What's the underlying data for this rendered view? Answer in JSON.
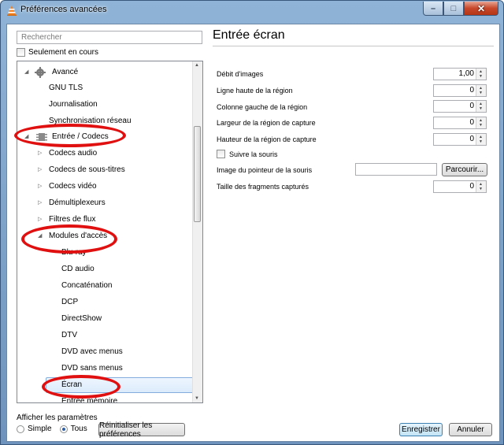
{
  "window": {
    "title": "Préférences avancées",
    "close_glyph": "✕",
    "min_glyph": "–",
    "max_glyph": "□"
  },
  "left": {
    "search_placeholder": "Rechercher",
    "only_current_label": "Seulement en cours",
    "tree": [
      {
        "label": "Avancé",
        "level": 0,
        "arrow": "◢",
        "icon": "gear-icon"
      },
      {
        "label": "GNU TLS",
        "level": 1
      },
      {
        "label": "Journalisation",
        "level": 1
      },
      {
        "label": "Synchronisation réseau",
        "level": 1
      },
      {
        "label": "Entrée / Codecs",
        "level": 0,
        "arrow": "◢",
        "icon": "codec-icon"
      },
      {
        "label": "Codecs audio",
        "level": 1,
        "arrow": "▷"
      },
      {
        "label": "Codecs de sous-titres",
        "level": 1,
        "arrow": "▷"
      },
      {
        "label": "Codecs vidéo",
        "level": 1,
        "arrow": "▷"
      },
      {
        "label": "Démultiplexeurs",
        "level": 1,
        "arrow": "▷"
      },
      {
        "label": "Filtres de flux",
        "level": 1,
        "arrow": "▷"
      },
      {
        "label": "Modules d'accès",
        "level": 1,
        "arrow": "◢"
      },
      {
        "label": "Blu-ray",
        "level": 2
      },
      {
        "label": "CD audio",
        "level": 2
      },
      {
        "label": "Concaténation",
        "level": 2
      },
      {
        "label": "DCP",
        "level": 2
      },
      {
        "label": "DirectShow",
        "level": 2
      },
      {
        "label": "DTV",
        "level": 2
      },
      {
        "label": "DVD avec menus",
        "level": 2
      },
      {
        "label": "DVD sans menus",
        "level": 2
      },
      {
        "label": "Écran",
        "level": 2,
        "selected": true
      },
      {
        "label": "Entrée mémoire",
        "level": 2
      }
    ],
    "show_params_label": "Afficher les paramètres",
    "radio_simple": "Simple",
    "radio_all": "Tous",
    "reset_button": "Réinitialiser les préférences"
  },
  "right": {
    "title": "Entrée écran",
    "fields": [
      {
        "label": "Débit d'images",
        "value": "1,00"
      },
      {
        "label": "Ligne haute de la région",
        "value": "0"
      },
      {
        "label": "Colonne gauche de la région",
        "value": "0"
      },
      {
        "label": "Largeur de la région de capture",
        "value": "0"
      },
      {
        "label": "Hauteur de la région de capture",
        "value": "0"
      }
    ],
    "follow_mouse_label": "Suivre la souris",
    "pointer_image_label": "Image du pointeur de la souris",
    "browse_button": "Parcourir...",
    "fragment_size_label": "Taille des fragments capturés",
    "fragment_size_value": "0"
  },
  "footer": {
    "save_button": "Enregistrer",
    "cancel_button": "Annuler"
  },
  "colors": {
    "annotation": "#e01010",
    "selection": "#dbebfb"
  }
}
